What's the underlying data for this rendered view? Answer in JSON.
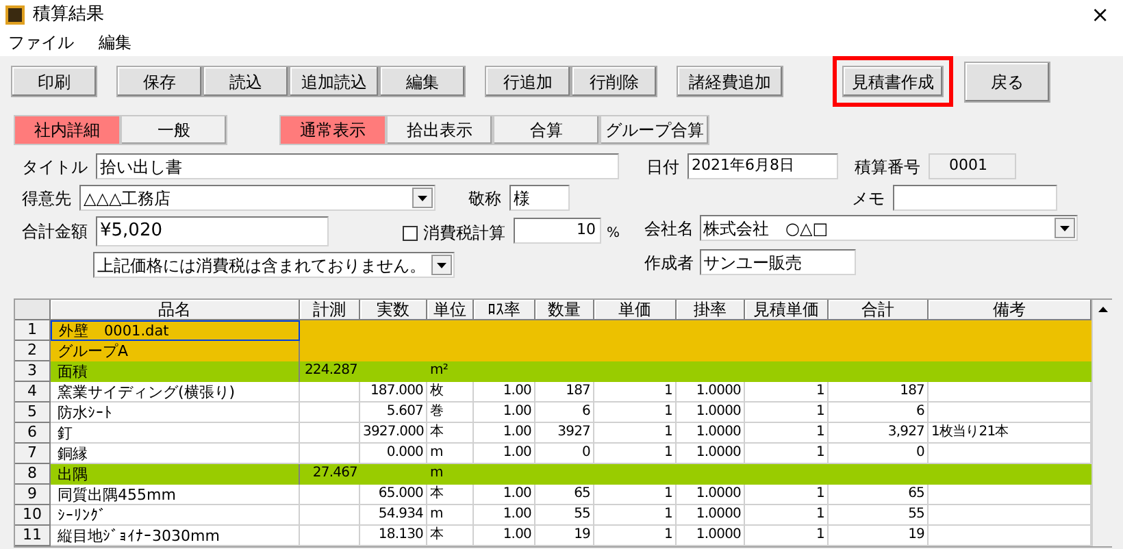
{
  "window": {
    "title": "積算結果",
    "close": "×"
  },
  "menu": [
    "ファイル",
    "編集"
  ],
  "toolbar": [
    {
      "buttons": [
        {
          "label": "印刷",
          "highlighted": false
        }
      ]
    },
    {
      "buttons": [
        {
          "label": "保存",
          "highlighted": false
        },
        {
          "label": "読込",
          "highlighted": false
        },
        {
          "label": "追加読込",
          "highlighted": false
        },
        {
          "label": "編集",
          "highlighted": false
        }
      ]
    },
    {
      "buttons": [
        {
          "label": "行追加",
          "highlighted": false
        },
        {
          "label": "行削除",
          "highlighted": false
        }
      ]
    },
    {
      "buttons": [
        {
          "label": "諸経費追加",
          "highlighted": false
        }
      ]
    },
    {
      "buttons": [
        {
          "label": "見積書作成",
          "highlighted": true
        }
      ]
    },
    {
      "buttons": [
        {
          "label": "戻る",
          "highlighted": false
        }
      ]
    }
  ],
  "detail_toggle": [
    {
      "label": "社内詳細",
      "selected": true
    },
    {
      "label": "一般",
      "selected": false
    }
  ],
  "view_toggle": [
    {
      "label": "通常表示",
      "selected": true
    },
    {
      "label": "拾出表示",
      "selected": false
    },
    {
      "label": "合算",
      "selected": false
    },
    {
      "label": "グループ合算",
      "selected": false
    }
  ],
  "form": {
    "title_label": "タイトル",
    "title_value": "拾い出し書",
    "date_label": "日付",
    "date_value": "2021年6月8日",
    "number_label": "積算番号",
    "number_value": "0001",
    "customer_label": "得意先",
    "customer_value": "△△△工務店",
    "honorific_label": "敬称",
    "honorific_value": "様",
    "memo_label": "メモ",
    "total_label": "合計金額",
    "total_value": "¥5,020",
    "tax_label": "消費税計算",
    "tax_checked": false,
    "tax_rate": "10",
    "tax_unit": "%",
    "company_label": "会社名",
    "company_value": "株式会社　○△□",
    "note_value": "上記価格には消費税は含まれておりません。",
    "author_label": "作成者",
    "author_value": "サンユー販売"
  },
  "table": {
    "columns": [
      "品名",
      "計測",
      "実数",
      "単位",
      "ﾛｽ率",
      "数量",
      "単価",
      "掛率",
      "見積単価",
      "合計",
      "備考"
    ],
    "rows": [
      {
        "no": "1",
        "kind": "group",
        "selected": true,
        "cells": [
          "外壁　0001.dat",
          "",
          "",
          "",
          "",
          "",
          "",
          "",
          "",
          "",
          ""
        ]
      },
      {
        "no": "2",
        "kind": "group",
        "selected": false,
        "cells": [
          "グループA",
          "",
          "",
          "",
          "",
          "",
          "",
          "",
          "",
          "",
          ""
        ]
      },
      {
        "no": "3",
        "kind": "section",
        "selected": false,
        "cells": [
          "面積",
          "224.287",
          "",
          "m²",
          "",
          "",
          "",
          "",
          "",
          "",
          ""
        ]
      },
      {
        "no": "4",
        "kind": "item",
        "selected": false,
        "cells": [
          "窯業サイディング(横張り)",
          "",
          "187.000",
          "枚",
          "1.00",
          "187",
          "1",
          "1.0000",
          "1",
          "187",
          ""
        ]
      },
      {
        "no": "5",
        "kind": "item",
        "selected": false,
        "cells": [
          "防水ｼｰﾄ",
          "",
          "5.607",
          "巻",
          "1.00",
          "6",
          "1",
          "1.0000",
          "1",
          "6",
          ""
        ]
      },
      {
        "no": "6",
        "kind": "item",
        "selected": false,
        "cells": [
          "釘",
          "",
          "3927.000",
          "本",
          "1.00",
          "3927",
          "1",
          "1.0000",
          "1",
          "3,927",
          "1枚当り21本"
        ]
      },
      {
        "no": "7",
        "kind": "item",
        "selected": false,
        "cells": [
          "銅縁",
          "",
          "0.000",
          "m",
          "1.00",
          "0",
          "1",
          "1.0000",
          "1",
          "0",
          ""
        ]
      },
      {
        "no": "8",
        "kind": "section",
        "selected": false,
        "cells": [
          "出隅",
          "27.467",
          "",
          "m",
          "",
          "",
          "",
          "",
          "",
          "",
          ""
        ]
      },
      {
        "no": "9",
        "kind": "item",
        "selected": false,
        "cells": [
          "同質出隅455mm",
          "",
          "65.000",
          "本",
          "1.00",
          "65",
          "1",
          "1.0000",
          "1",
          "65",
          ""
        ]
      },
      {
        "no": "10",
        "kind": "item",
        "selected": false,
        "cells": [
          "ｼｰﾘﾝｸﾞ",
          "",
          "54.934",
          "m",
          "1.00",
          "55",
          "1",
          "1.0000",
          "1",
          "55",
          ""
        ]
      },
      {
        "no": "11",
        "kind": "item",
        "selected": false,
        "cells": [
          "縦目地ｼﾞｮｲﾅｰ3030mm",
          "",
          "18.130",
          "本",
          "1.00",
          "19",
          "1",
          "1.0000",
          "1",
          "19",
          ""
        ]
      }
    ]
  }
}
